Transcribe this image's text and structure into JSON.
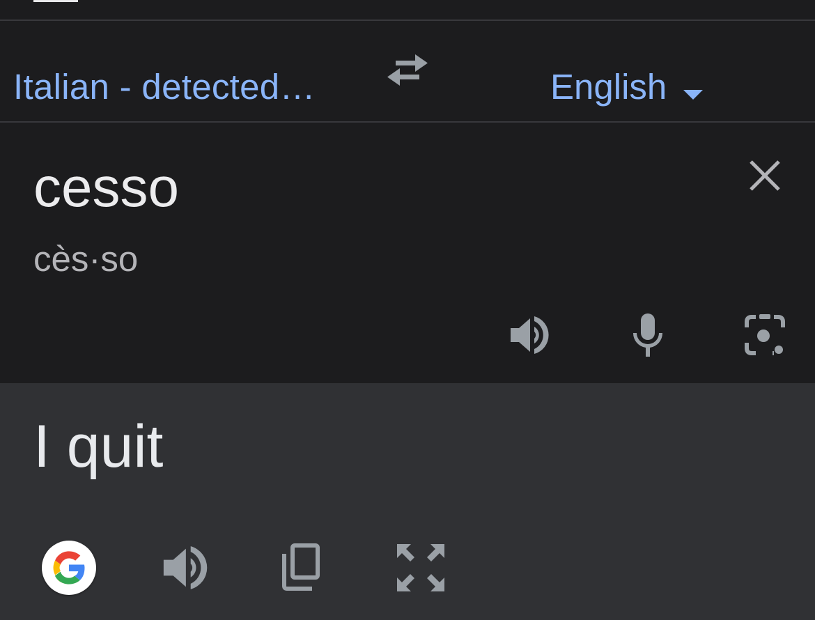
{
  "languages": {
    "source_label": "Italian - detected…",
    "target_label": "English",
    "swap_icon": "swap-arrows-icon",
    "dropdown_icon": "caret-down-icon"
  },
  "input": {
    "text": "cesso",
    "phonetic": "cès·so",
    "clear_icon": "close-icon",
    "tools": [
      "speaker-icon",
      "microphone-icon",
      "camera-icon"
    ]
  },
  "output": {
    "text": "I quit",
    "tools": [
      "google-logo-icon",
      "speaker-icon",
      "copy-icon",
      "fullscreen-icon"
    ]
  },
  "colors": {
    "background": "#1c1c1e",
    "output_card": "#303134",
    "accent_blue": "#8ab4f8",
    "icon_gray": "#9aa0a6",
    "text_primary": "#e8eaed",
    "text_secondary": "#b4b4b8"
  }
}
